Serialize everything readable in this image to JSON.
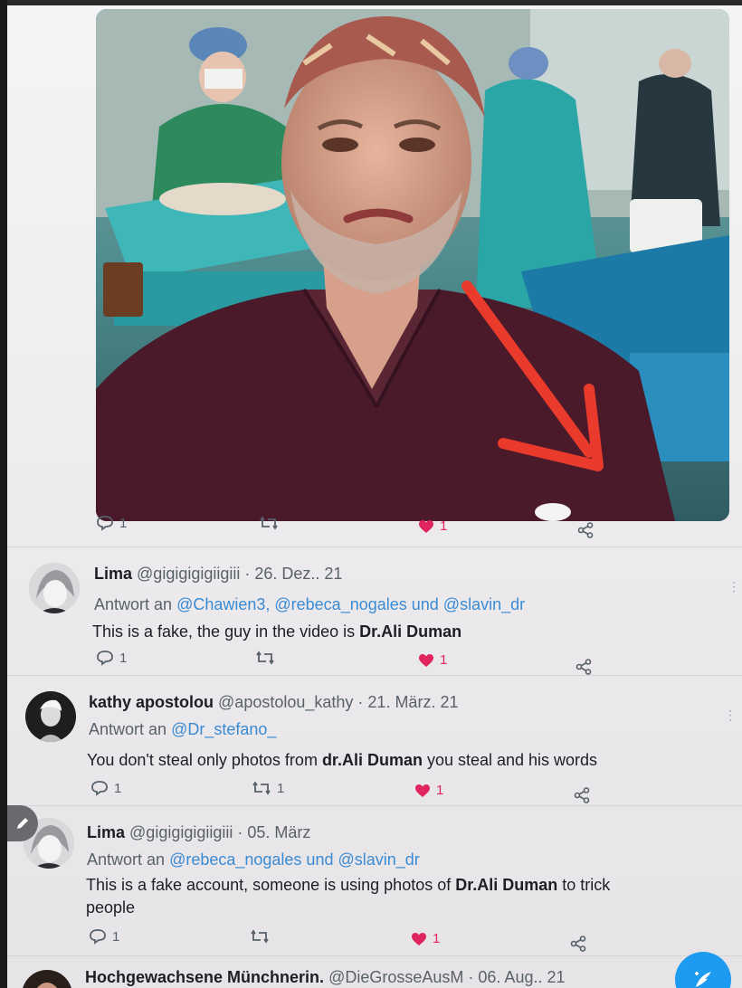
{
  "photo_tweet": {
    "reply_count": "1",
    "like_count": "1"
  },
  "replies": [
    {
      "name": "Lima",
      "handle": "@gigigigigiigiii",
      "date": "· 26. Dez.. 21",
      "reply_prefix": "Antwort an",
      "mentions": "@Chawien3, @rebeca_nogales und @slavin_dr",
      "text_before": "This is a fake, the guy in the video is ",
      "text_bold": "Dr.Ali Duman",
      "text_after": "",
      "reply_count": "1",
      "retweet_count": "",
      "like_count": "1"
    },
    {
      "name": "kathy apostolou",
      "handle": "@apostolou_kathy",
      "date": "· 21. März. 21",
      "reply_prefix": "Antwort an",
      "mentions": "@Dr_stefano_",
      "text_before": "You don't steal only photos from ",
      "text_bold": "dr.Ali Duman",
      "text_after": " you steal and his words",
      "reply_count": "1",
      "retweet_count": "1",
      "like_count": "1"
    },
    {
      "name": "Lima",
      "handle": "@gigigigigiigiii",
      "date": "· 05. März",
      "reply_prefix": "Antwort an",
      "mentions": "@rebeca_nogales und @slavin_dr",
      "text_before": "This is a fake account, someone is using photos of ",
      "text_bold": "Dr.Ali Duman",
      "text_after": " to trick",
      "text_line2": "people",
      "reply_count": "1",
      "retweet_count": "",
      "like_count": "1"
    },
    {
      "name": "Hochgewachsene Münchnerin.",
      "handle": "@DieGrosseAusM",
      "date": "· 06. Aug.. 21"
    }
  ],
  "colors": {
    "like": "#e0245e",
    "link": "#3b8bd4",
    "compose": "#1d9bf0"
  },
  "icons": [
    "reply-icon",
    "retweet-icon",
    "heart-icon",
    "share-icon",
    "more-icon",
    "edit-icon",
    "compose-icon"
  ]
}
